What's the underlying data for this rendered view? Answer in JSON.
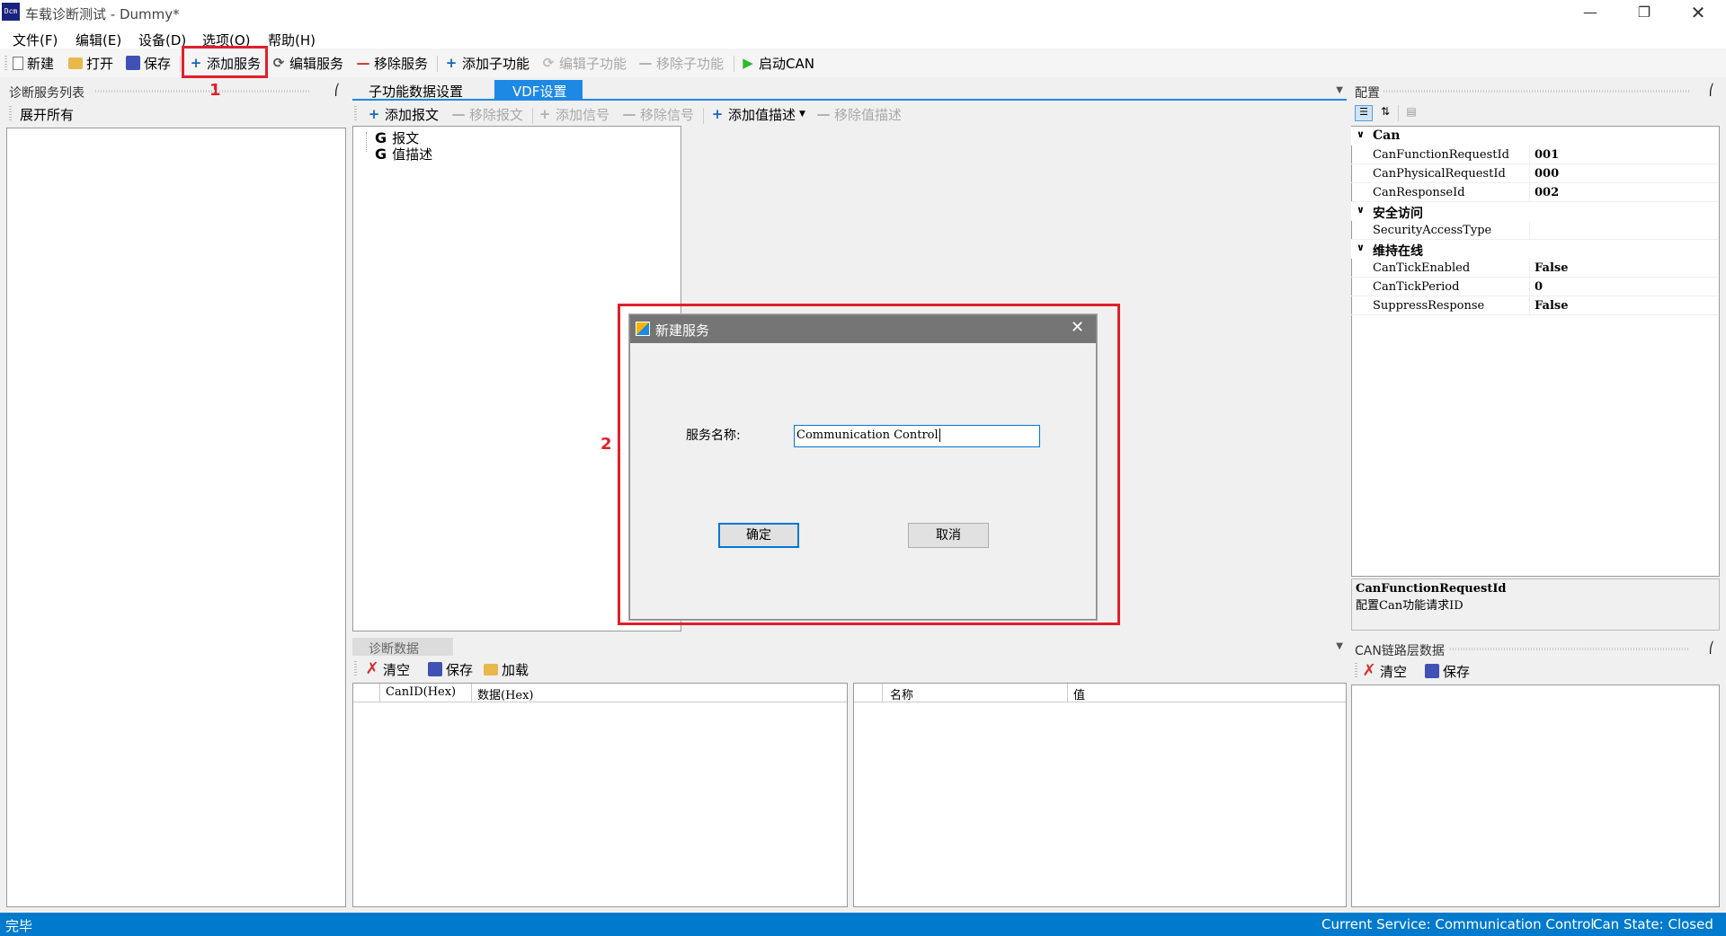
{
  "window": {
    "title": "车载诊断测试 - Dummy*",
    "icon_text": "Dcm"
  },
  "menu": [
    "文件(F)",
    "编辑(E)",
    "设备(D)",
    "选项(O)",
    "帮助(H)"
  ],
  "toolbar": {
    "new": "新建",
    "open": "打开",
    "save": "保存",
    "add_service": "添加服务",
    "edit_service": "编辑服务",
    "remove_service": "移除服务",
    "add_subfunc": "添加子功能",
    "edit_subfunc": "编辑子功能",
    "remove_subfunc": "移除子功能",
    "start_can": "启动CAN"
  },
  "annotations": {
    "one": "1",
    "two": "2"
  },
  "left_panel": {
    "title": "诊断服务列表",
    "expand_all": "展开所有"
  },
  "tabs": [
    "子功能数据设置",
    "VDF设置"
  ],
  "vdf_toolbar": {
    "add_msg": "添加报文",
    "remove_msg": "移除报文",
    "add_signal": "添加信号",
    "remove_signal": "移除信号",
    "add_valdesc": "添加值描述",
    "remove_valdesc": "移除值描述"
  },
  "tree": [
    {
      "icon": "G",
      "label": "报文"
    },
    {
      "icon": "G",
      "label": "值描述"
    }
  ],
  "dialog": {
    "title": "新建服务",
    "field_label": "服务名称:",
    "field_value": "Communication Control",
    "ok": "确定",
    "cancel": "取消"
  },
  "config_panel": {
    "title": "配置",
    "categories": [
      {
        "name": "Can",
        "props": [
          {
            "key": "CanFunctionRequestId",
            "value": "001"
          },
          {
            "key": "CanPhysicalRequestId",
            "value": "000"
          },
          {
            "key": "CanResponseId",
            "value": "002"
          }
        ]
      },
      {
        "name": "安全访问",
        "props": [
          {
            "key": "SecurityAccessType",
            "value": ""
          }
        ]
      },
      {
        "name": "维持在线",
        "props": [
          {
            "key": "CanTickEnabled",
            "value": "False"
          },
          {
            "key": "CanTickPeriod",
            "value": "0"
          },
          {
            "key": "SuppressResponse",
            "value": "False"
          }
        ]
      }
    ],
    "desc_title": "CanFunctionRequestId",
    "desc_text": "配置Can功能请求ID"
  },
  "diag_data": {
    "title": "诊断数据",
    "clear": "清空",
    "save": "保存",
    "load": "加载",
    "left_cols": [
      "CanID(Hex)",
      "数据(Hex)"
    ],
    "right_cols": [
      "名称",
      "值"
    ]
  },
  "can_panel": {
    "title": "CAN链路层数据",
    "clear": "清空",
    "save": "保存"
  },
  "status": {
    "left": "完毕",
    "service": "Current Service: Communication Control",
    "can_state": "Can State: Closed"
  }
}
